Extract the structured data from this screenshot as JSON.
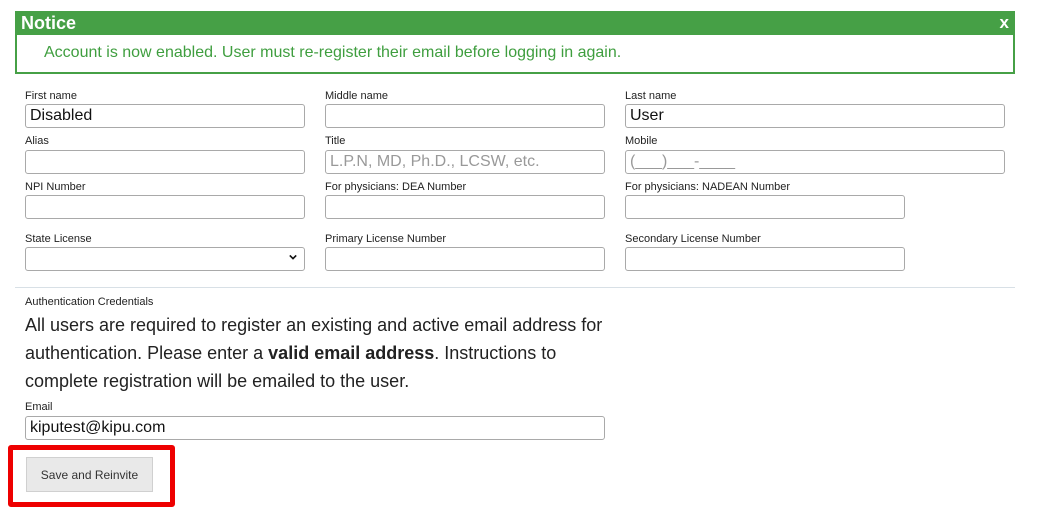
{
  "notice": {
    "title": "Notice",
    "close": "x",
    "message": "Account is now enabled. User must re-register their email before logging in again."
  },
  "form": {
    "first_name": {
      "label": "First name",
      "value": "Disabled"
    },
    "middle_name": {
      "label": "Middle name",
      "value": ""
    },
    "last_name": {
      "label": "Last name",
      "value": "User"
    },
    "alias": {
      "label": "Alias",
      "value": ""
    },
    "title": {
      "label": "Title",
      "value": "",
      "placeholder": "L.P.N, MD, Ph.D., LCSW, etc."
    },
    "mobile": {
      "label": "Mobile",
      "value": "",
      "placeholder": "(___)___-____"
    },
    "npi": {
      "label": "NPI Number",
      "value": ""
    },
    "dea": {
      "label": "For physicians: DEA Number",
      "value": ""
    },
    "nadean": {
      "label": "For physicians: NADEAN Number",
      "value": ""
    },
    "state_license": {
      "label": "State License",
      "value": ""
    },
    "primary_license": {
      "label": "Primary License Number",
      "value": ""
    },
    "secondary_license": {
      "label": "Secondary License Number",
      "value": ""
    }
  },
  "auth": {
    "section_label": "Authentication Credentials",
    "text_before": "All users are required to register an existing and active email address for authentication. Please enter a ",
    "text_bold": "valid email address",
    "text_after": ". Instructions to complete registration will be emailed to the user.",
    "email_label": "Email",
    "email_value": "kiputest@kipu.com"
  },
  "actions": {
    "save_reinvite": "Save and Reinvite"
  },
  "colors": {
    "notice_green": "#46a046",
    "highlight_red": "#ee0000"
  }
}
